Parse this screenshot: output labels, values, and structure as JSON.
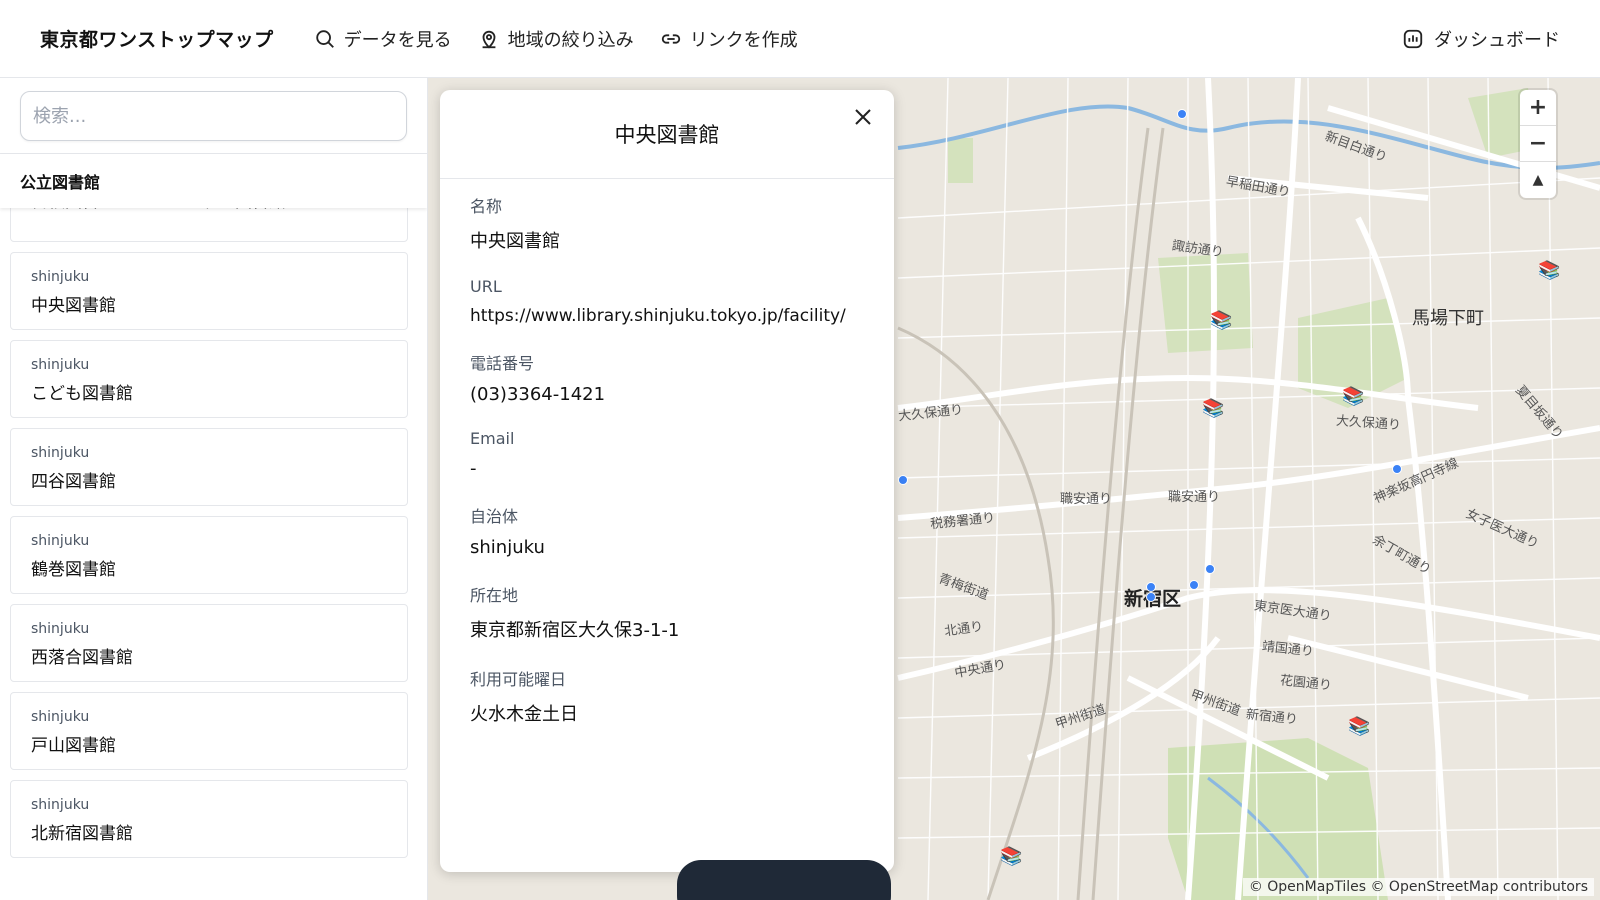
{
  "header": {
    "brand": "東京都ワンストップマップ",
    "nav": [
      {
        "label": "データを見る",
        "icon": "search-icon"
      },
      {
        "label": "地域の絞り込み",
        "icon": "location-pin-icon"
      },
      {
        "label": "リンクを作成",
        "icon": "link-icon"
      }
    ],
    "dashboard": {
      "label": "ダッシュボード",
      "icon": "bar-chart-icon"
    }
  },
  "sidebar": {
    "search_placeholder": "検索...",
    "category": "公立図書館",
    "items": [
      {
        "municipality": "",
        "name": "日根図書サービススポット図書館"
      },
      {
        "municipality": "shinjuku",
        "name": "中央図書館"
      },
      {
        "municipality": "shinjuku",
        "name": "こども図書館"
      },
      {
        "municipality": "shinjuku",
        "name": "四谷図書館"
      },
      {
        "municipality": "shinjuku",
        "name": "鶴巻図書館"
      },
      {
        "municipality": "shinjuku",
        "name": "西落合図書館"
      },
      {
        "municipality": "shinjuku",
        "name": "戸山図書館"
      },
      {
        "municipality": "shinjuku",
        "name": "北新宿図書館"
      }
    ]
  },
  "detail": {
    "title": "中央図書館",
    "fields": [
      {
        "label": "名称",
        "value": "中央図書館"
      },
      {
        "label": "URL",
        "value": "https://www.library.shinjuku.tokyo.jp/facility/"
      },
      {
        "label": "電話番号",
        "value": "(03)3364-1421"
      },
      {
        "label": "Email",
        "value": "-"
      },
      {
        "label": "自治体",
        "value": "shinjuku"
      },
      {
        "label": "所在地",
        "value": "東京都新宿区大久保3-1-1"
      },
      {
        "label": "利用可能曜日",
        "value": "火水木金土日"
      }
    ]
  },
  "map": {
    "district": "新宿区",
    "labels": {
      "babashita": "馬場下町",
      "shinmejiro": "新目白通り",
      "waseda": "早稲田通り",
      "suwa": "諏訪通り",
      "okubo1": "大久保通り",
      "okubo2": "大久保通り",
      "shokuan1": "職安通り",
      "shokuan2": "職安通り",
      "zeimusho": "税務署通り",
      "ome": "青梅街道",
      "kita": "北通り",
      "chuo": "中央通り",
      "koshu1": "甲州街道",
      "koshu2": "甲州街道",
      "tokyoidai": "東京医大通り",
      "yasukuni": "靖国通り",
      "hanazono": "花園通り",
      "shinjuku_dori": "新宿通り",
      "kagurazaka": "神楽坂高円寺線",
      "joshiidai": "女子医大通り",
      "yochomachi": "余丁町通り",
      "natsume": "夏目坂通り"
    },
    "zoom_in": "+",
    "zoom_out": "−",
    "compass": "▲",
    "attribution": "© OpenMapTiles © OpenStreetMap contributors"
  },
  "colors": {
    "marker": "#3b82f6",
    "map_bg": "#ebe7df",
    "park": "#d4e2bd",
    "water": "#8bb8e0"
  }
}
